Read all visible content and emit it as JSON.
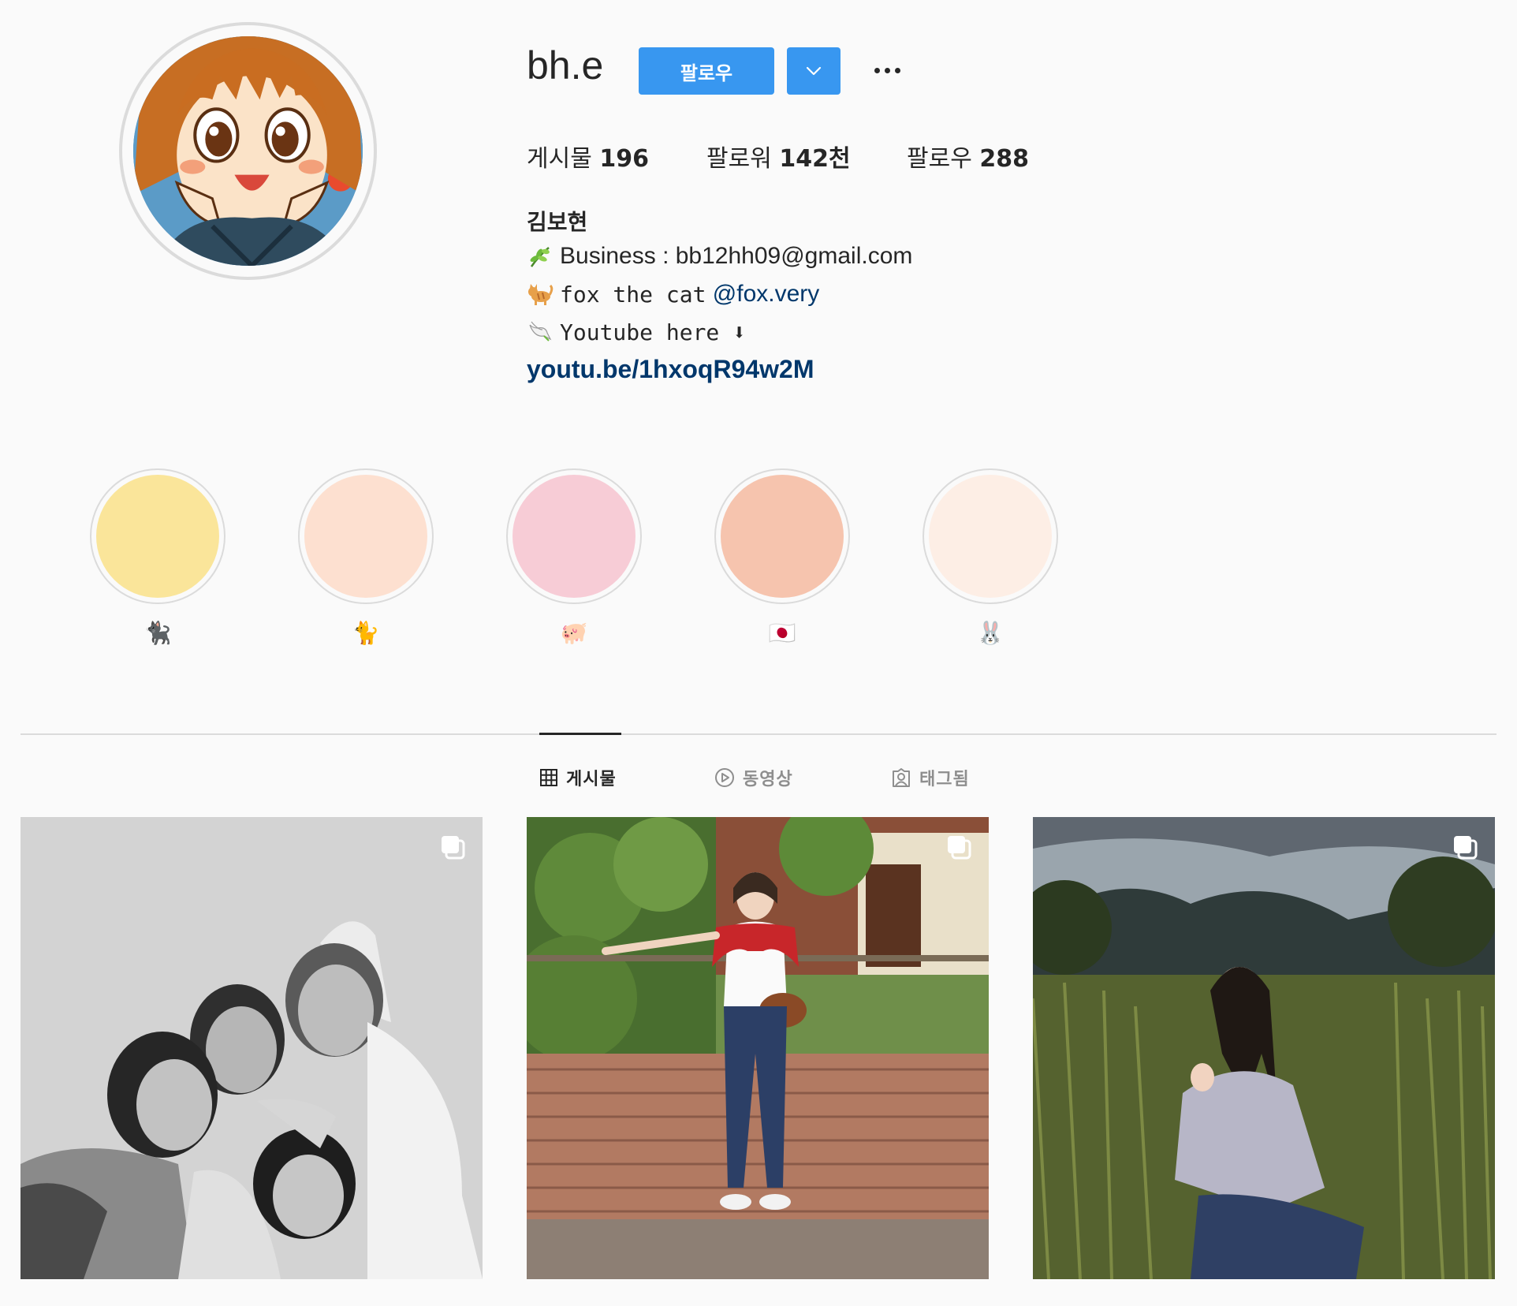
{
  "profile": {
    "username": "bh.e",
    "follow_label": "팔로우",
    "more_icon": "more-horizontal-icon",
    "dropdown_icon": "chevron-down-icon",
    "stats": {
      "posts_label": "게시물",
      "posts_value": "196",
      "followers_label": "팔로워",
      "followers_value": "142천",
      "following_label": "팔로우",
      "following_value": "288"
    },
    "full_name": "김보현",
    "bio": {
      "line1_emoji": "herb-emoji",
      "line1": "Business : bb12hh09@gmail.com",
      "line2_emoji": "cat-emoji",
      "line2_text": "fox the cat ",
      "line2_mention": "@fox.very",
      "line3_emoji": "dove-emoji",
      "line3_text": "Youtube here ⬇",
      "link": "youtu.be/1hxoqR94w2M"
    }
  },
  "highlights": [
    {
      "label": "🐈‍⬛",
      "color": "#fae59a"
    },
    {
      "label": "🐈",
      "color": "#fde0d0"
    },
    {
      "label": "🐖",
      "color": "#f7ccd6"
    },
    {
      "label": "🇯🇵",
      "color": "#f6c4ae"
    },
    {
      "label": "🐰",
      "color": "#fdeee5"
    }
  ],
  "tabs": [
    {
      "label": "게시물",
      "icon": "grid-icon",
      "active": true
    },
    {
      "label": "동영상",
      "icon": "play-circle-icon",
      "active": false
    },
    {
      "label": "태그됨",
      "icon": "tagged-user-icon",
      "active": false
    }
  ],
  "posts": [
    {
      "type": "carousel",
      "icon": "carousel-icon"
    },
    {
      "type": "carousel",
      "icon": "carousel-icon"
    },
    {
      "type": "carousel",
      "icon": "carousel-icon"
    }
  ],
  "colors": {
    "accent": "#3897f0",
    "link": "#00376b",
    "background": "#fafafa",
    "border": "#dbdbdb"
  }
}
